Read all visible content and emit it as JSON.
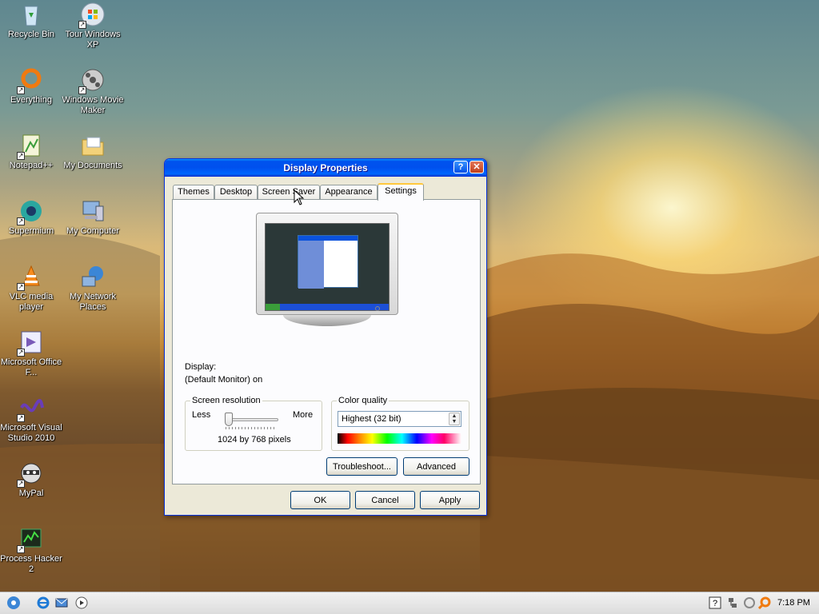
{
  "desktop": {
    "icons": [
      {
        "label": "Recycle Bin"
      },
      {
        "label": "Tour Windows XP"
      },
      {
        "label": "Everything"
      },
      {
        "label": "Windows Movie Maker"
      },
      {
        "label": "Notepad++"
      },
      {
        "label": "My Documents"
      },
      {
        "label": "Supermium"
      },
      {
        "label": "My Computer"
      },
      {
        "label": "VLC media player"
      },
      {
        "label": "My Network Places"
      },
      {
        "label": "Microsoft Office F..."
      },
      {
        "label": "Microsoft Visual Studio 2010"
      },
      {
        "label": "MyPal"
      },
      {
        "label": "Process Hacker 2"
      }
    ]
  },
  "window": {
    "title": "Display Properties",
    "help_glyph": "?",
    "close_glyph": "✕",
    "tabs": [
      {
        "label": "Themes"
      },
      {
        "label": "Desktop"
      },
      {
        "label": "Screen Saver"
      },
      {
        "label": "Appearance"
      },
      {
        "label": "Settings"
      }
    ],
    "active_tab": "Settings",
    "display_label": "Display:",
    "display_value": "(Default Monitor) on",
    "screen_resolution": {
      "legend": "Screen resolution",
      "less": "Less",
      "more": "More",
      "value_text": "1024 by 768 pixels",
      "slider_position": 0.05
    },
    "color_quality": {
      "legend": "Color quality",
      "selected": "Highest (32 bit)"
    },
    "buttons": {
      "troubleshoot": "Troubleshoot...",
      "advanced": "Advanced",
      "ok": "OK",
      "cancel": "Cancel",
      "apply": "Apply"
    }
  },
  "taskbar": {
    "clock": "7:18 PM",
    "quick_launch": [
      "internet-explorer-icon",
      "outlook-express-icon",
      "media-player-icon"
    ]
  },
  "colors": {
    "titlebar": "#0054e3",
    "tab_highlight": "#ffc83c",
    "window_bg": "#ece9d8"
  }
}
